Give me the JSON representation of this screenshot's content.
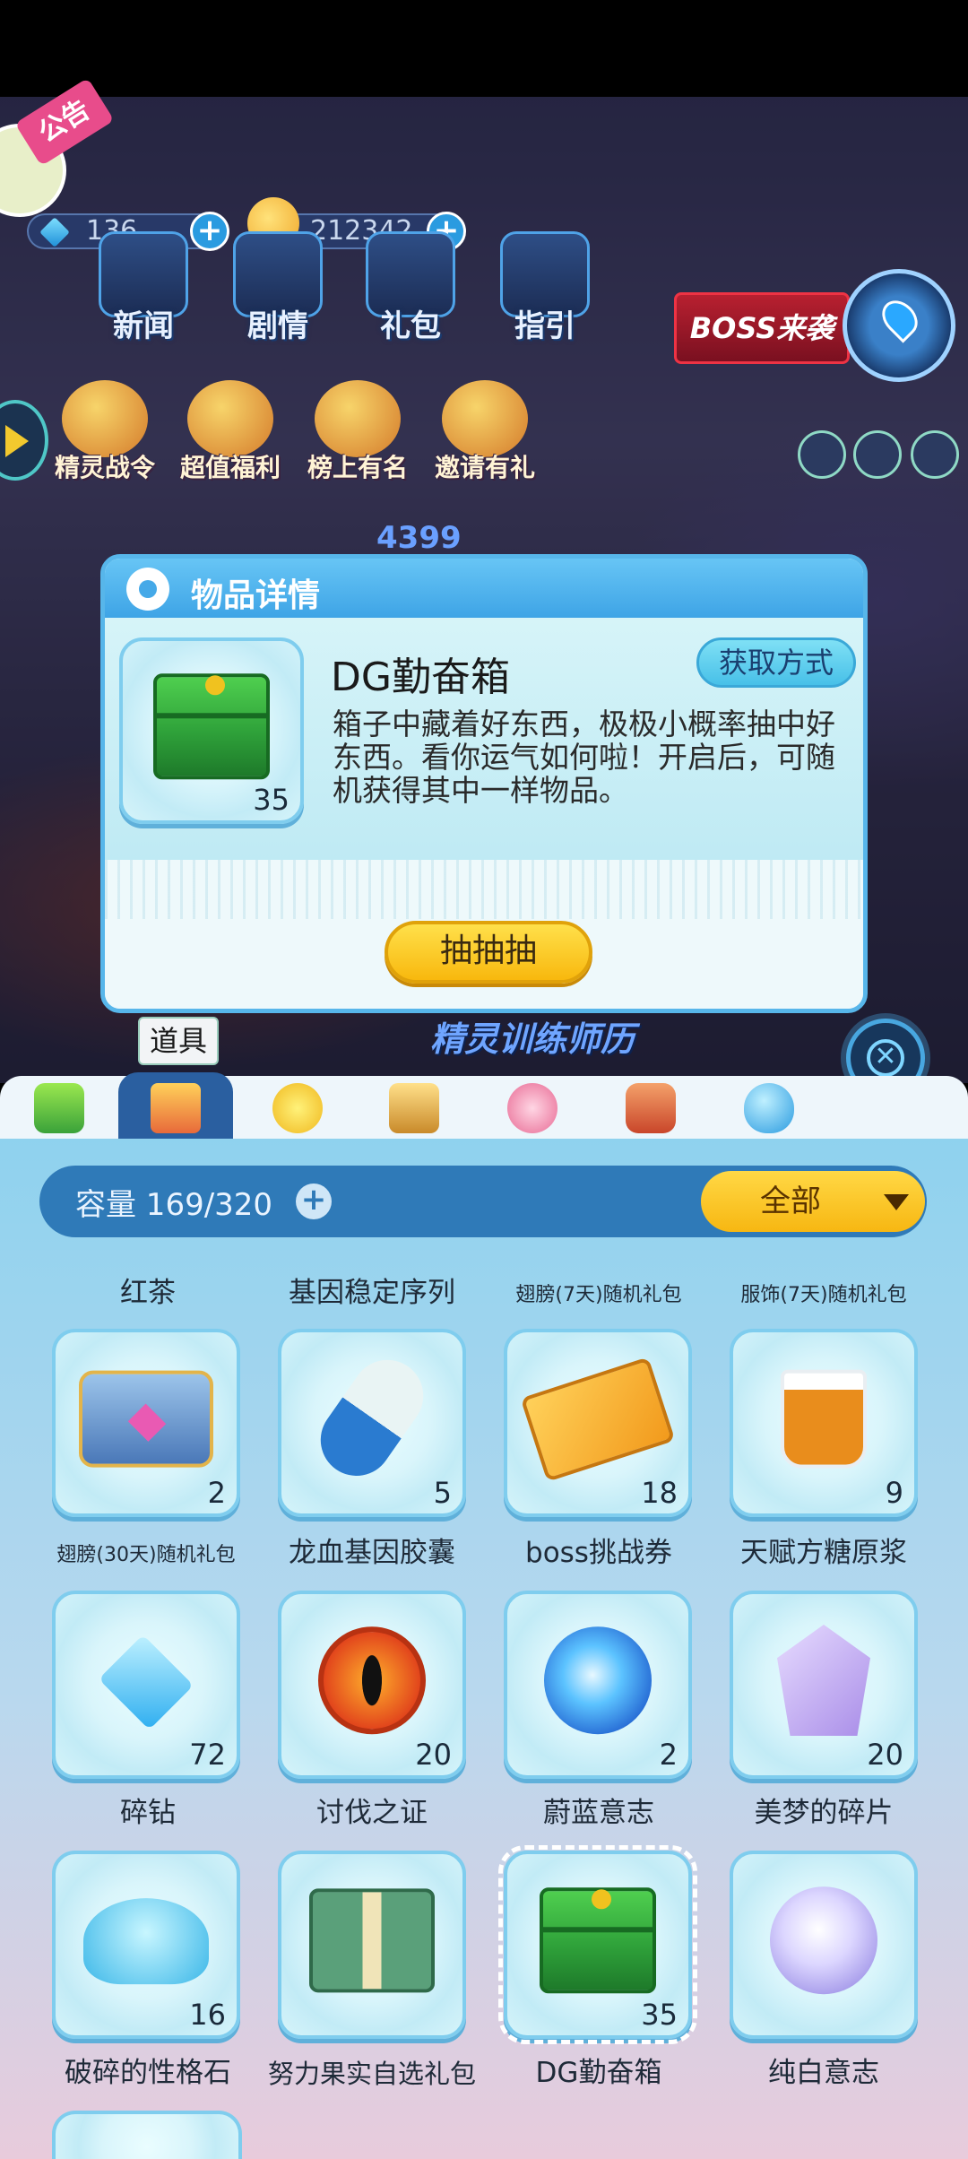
{
  "hud": {
    "gems": "136",
    "coins": "212342"
  },
  "notice_badge": "公告",
  "top_icons": [
    "新闻",
    "剧情",
    "礼包",
    "指引"
  ],
  "activity_icons": [
    "精灵战令",
    "超值福利",
    "榜上有名",
    "邀请有礼"
  ],
  "boss_banner": "BOSS来袭",
  "score_strip": "4399",
  "trainer_text": "精灵训练师历",
  "popup": {
    "title": "物品详情",
    "item_name": "DG勤奋箱",
    "item_count": "35",
    "get_method_label": "获取方式",
    "description": "箱子中藏着好东西，极极小概率抽中好东西。看你运气如何啦！开启后，可随机获得其中一样物品。",
    "draw_label": "抽抽抽"
  },
  "close_icon": "close-x-icon",
  "tabs": {
    "tooltip": "道具",
    "icons": [
      "energy-battery-icon",
      "items-bag-icon",
      "star-accessory-icon",
      "trophy-icon",
      "dress-icon",
      "rocking-horse-icon",
      "egg-icon"
    ],
    "active_index": 1
  },
  "bag": {
    "capacity_label": "容量 169/320",
    "filter_label": "全部",
    "header_labels": [
      "红茶",
      "基因稳定序列",
      "翅膀(7天)随机礼包",
      "服饰(7天)随机礼包"
    ],
    "items": [
      {
        "name": "翅膀(30天)随机礼包",
        "count": "2",
        "art": "chest-blue"
      },
      {
        "name": "龙血基因胶囊",
        "count": "5",
        "art": "capsule"
      },
      {
        "name": "boss挑战券",
        "count": "18",
        "art": "ticket"
      },
      {
        "name": "天赋方糖原浆",
        "count": "9",
        "art": "cup"
      },
      {
        "name": "碎钻",
        "count": "72",
        "art": "crystal"
      },
      {
        "name": "讨伐之证",
        "count": "20",
        "art": "eye-orb"
      },
      {
        "name": "蔚蓝意志",
        "count": "2",
        "art": "blue-orb"
      },
      {
        "name": "美梦的碎片",
        "count": "20",
        "art": "purple-gem"
      },
      {
        "name": "破碎的性格石",
        "count": "16",
        "art": "ice-pile"
      },
      {
        "name": "努力果实自选礼包",
        "count": "",
        "art": "giftbox"
      },
      {
        "name": "DG勤奋箱",
        "count": "35",
        "art": "box-green",
        "selected": true
      },
      {
        "name": "纯白意志",
        "count": "",
        "art": "white-orb"
      }
    ]
  },
  "colors": {
    "accent_blue": "#3ea4e6",
    "button_yellow": "#f8b80e",
    "panel_bg": "#8fd2ee"
  }
}
